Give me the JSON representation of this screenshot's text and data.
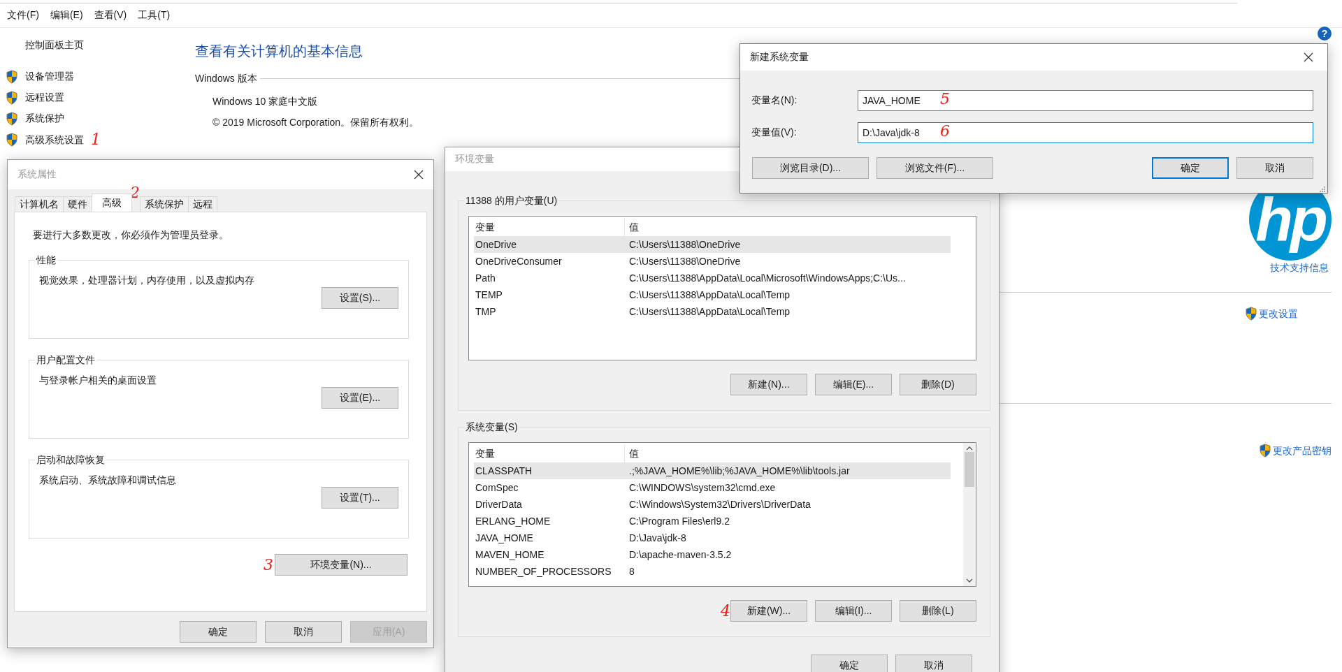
{
  "menu_bar": [
    "文件(F)",
    "编辑(E)",
    "查看(V)",
    "工具(T)"
  ],
  "sidebar": {
    "home": "控制面板主页",
    "items": [
      {
        "label": "设备管理器"
      },
      {
        "label": "远程设置"
      },
      {
        "label": "系统保护"
      },
      {
        "label": "高级系统设置",
        "annotation": "1"
      }
    ]
  },
  "main": {
    "heading": "查看有关计算机的基本信息",
    "section": "Windows 版本",
    "edition": "Windows 10 家庭中文版",
    "copyright": "© 2019 Microsoft Corporation。保留所有权利。"
  },
  "right_panel": {
    "help": "?",
    "logo": "hp",
    "support_link": "技术支持信息",
    "links": [
      "更改设置",
      "更改产品密钥"
    ]
  },
  "system_properties": {
    "title": "系统属性",
    "tabs": [
      {
        "label": "计算机名",
        "selected": false
      },
      {
        "label": "硬件",
        "selected": false
      },
      {
        "label": "高级",
        "selected": true,
        "annotation": "2"
      },
      {
        "label": "系统保护",
        "selected": false
      },
      {
        "label": "远程",
        "selected": false
      }
    ],
    "notice": "要进行大多数更改，你必须作为管理员登录。",
    "groups": [
      {
        "title": "性能",
        "description": "视觉效果，处理器计划，内存使用，以及虚拟内存",
        "button": "设置(S)..."
      },
      {
        "title": "用户配置文件",
        "description": "与登录帐户相关的桌面设置",
        "button": "设置(E)..."
      },
      {
        "title": "启动和故障恢复",
        "description": "系统启动、系统故障和调试信息",
        "button": "设置(T)..."
      }
    ],
    "env_button": {
      "label": "环境变量(N)...",
      "annotation": "3"
    },
    "buttons": [
      {
        "label": "确定",
        "disabled": false
      },
      {
        "label": "取消",
        "disabled": false
      },
      {
        "label": "应用(A)",
        "disabled": true
      }
    ]
  },
  "environment_variables": {
    "title": "环境变量",
    "user_group": "11388 的用户变量(U)",
    "user_table": {
      "columns": [
        "变量",
        "值"
      ],
      "rows": [
        {
          "name": "OneDrive",
          "value": "C:\\Users\\11388\\OneDrive",
          "selected": true
        },
        {
          "name": "OneDriveConsumer",
          "value": "C:\\Users\\11388\\OneDrive",
          "selected": false
        },
        {
          "name": "Path",
          "value": "C:\\Users\\11388\\AppData\\Local\\Microsoft\\WindowsApps;C:\\Us...",
          "selected": false
        },
        {
          "name": "TEMP",
          "value": "C:\\Users\\11388\\AppData\\Local\\Temp",
          "selected": false
        },
        {
          "name": "TMP",
          "value": "C:\\Users\\11388\\AppData\\Local\\Temp",
          "selected": false
        }
      ]
    },
    "user_buttons": [
      {
        "label": "新建(N)..."
      },
      {
        "label": "编辑(E)..."
      },
      {
        "label": "删除(D)"
      }
    ],
    "system_group": "系统变量(S)",
    "system_table": {
      "columns": [
        "变量",
        "值"
      ],
      "rows": [
        {
          "name": "CLASSPATH",
          "value": ".;%JAVA_HOME%\\lib;%JAVA_HOME%\\lib\\tools.jar",
          "selected": true
        },
        {
          "name": "ComSpec",
          "value": "C:\\WINDOWS\\system32\\cmd.exe",
          "selected": false
        },
        {
          "name": "DriverData",
          "value": "C:\\Windows\\System32\\Drivers\\DriverData",
          "selected": false
        },
        {
          "name": "ERLANG_HOME",
          "value": "C:\\Program Files\\erl9.2",
          "selected": false
        },
        {
          "name": "JAVA_HOME",
          "value": "D:\\Java\\jdk-8",
          "selected": false
        },
        {
          "name": "MAVEN_HOME",
          "value": "D:\\apache-maven-3.5.2",
          "selected": false
        },
        {
          "name": "NUMBER_OF_PROCESSORS",
          "value": "8",
          "selected": false
        }
      ]
    },
    "system_buttons": [
      {
        "label": "新建(W)...",
        "annotation": "4"
      },
      {
        "label": "编辑(I)..."
      },
      {
        "label": "删除(L)"
      }
    ],
    "buttons": [
      {
        "label": "确定"
      },
      {
        "label": "取消"
      }
    ]
  },
  "new_variable": {
    "title": "新建系统变量",
    "fields": [
      {
        "label": "变量名(N):",
        "value": "JAVA_HOME",
        "focused": false,
        "annotation": "5"
      },
      {
        "label": "变量值(V):",
        "value": "D:\\Java\\jdk-8",
        "focused": true,
        "annotation": "6"
      }
    ],
    "browse_buttons": [
      {
        "label": "浏览目录(D)..."
      },
      {
        "label": "浏览文件(F)..."
      }
    ],
    "buttons": [
      {
        "label": "确定",
        "default": true
      },
      {
        "label": "取消",
        "default": false
      }
    ]
  }
}
